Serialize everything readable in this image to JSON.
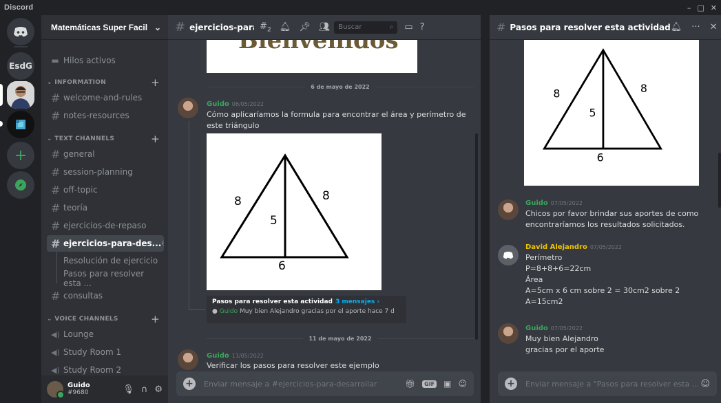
{
  "app": {
    "title": "Discord",
    "window_controls": [
      "–",
      "□",
      "✕"
    ]
  },
  "servers": {
    "esdg_label": "EsdG"
  },
  "guild": {
    "name": "Matemáticas Super Facil"
  },
  "sidebar": {
    "active_threads": "Hilos activos",
    "categories": {
      "information": "INFORMATION",
      "text": "TEXT CHANNELS",
      "voice": "VOICE CHANNELS"
    },
    "info_channels": [
      "welcome-and-rules",
      "notes-resources"
    ],
    "text_channels": [
      "general",
      "session-planning",
      "off-topic",
      "teoría",
      "ejercicios-de-repaso",
      "ejercicios-para-des...",
      "consultas"
    ],
    "threads": [
      "Resolución de ejercicio",
      "Pasos para resolver esta ..."
    ],
    "voice_channels": [
      "Lounge",
      "Study Room 1",
      "Study Room 2"
    ]
  },
  "user": {
    "name": "Guido",
    "tag": "#9680"
  },
  "channel": {
    "name": "ejercicios-para-c",
    "threads_count": "2",
    "search_placeholder": "Buscar",
    "composer_placeholder": "Enviar mensaje a #ejercicios-para-desarrollar",
    "gif_label": "GIF"
  },
  "messages": {
    "divider1": "6 de mayo de 2022",
    "divider2": "11 de mayo de 2022",
    "m1": {
      "author": "Guido",
      "timestamp": "06/05/2022",
      "line1": "Cómo aplicaríamos la formula para encontrar el área y perímetro de",
      "line2": "este triángulo"
    },
    "thread_card": {
      "title": "Pasos para resolver esta actividad",
      "count": "3 mensajes ›",
      "preview_author": "Guido",
      "preview_text": "Muy bien Alejandro  gracias por el  aporte",
      "preview_time": "hace 7 d"
    },
    "m2": {
      "author": "Guido",
      "timestamp": "11/05/2022",
      "line1": "Verificar los pasos para resolver este ejemplo"
    }
  },
  "triangle": {
    "left": "8",
    "right": "8",
    "height": "5",
    "base": "6"
  },
  "thread_panel": {
    "title": "Pasos para resolver esta actividad",
    "composer_placeholder": "Enviar mensaje a \"Pasos para resolver esta ...",
    "m1": {
      "author": "Guido",
      "timestamp": "07/05/2022",
      "line1": "Chicos por favor brindar sus aportes de como",
      "line2": "encontraríamos los resultados solicitados."
    },
    "m2": {
      "author": "David Alejandro",
      "timestamp": "07/05/2022",
      "lines": [
        "Perímetro",
        "P=8+8+6=22cm",
        "Área",
        "A=5cm x 6 cm sobre 2 = 30cm2 sobre  2",
        "A=15cm2"
      ]
    },
    "m3": {
      "author": "Guido",
      "timestamp": "07/05/2022",
      "line1": "Muy bien Alejandro",
      "line2": "gracias por el  aporte"
    }
  }
}
